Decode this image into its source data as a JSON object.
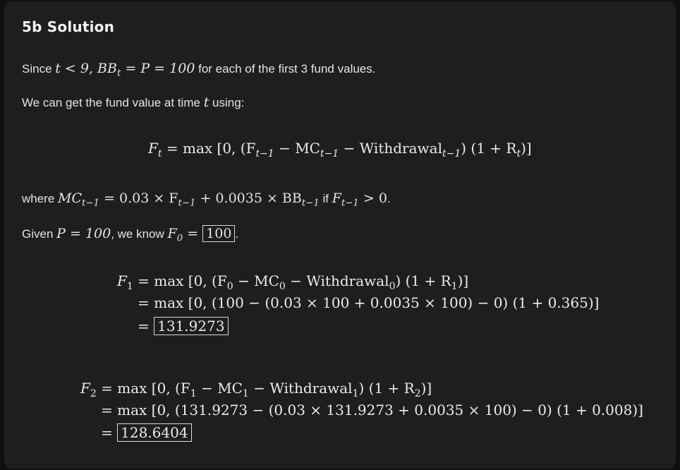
{
  "title": "5b Solution",
  "intro": {
    "prefix": "Since ",
    "cond": "t < 9, BB",
    "cond_sub": "t",
    "cond_rest": " = P = 100",
    "suffix": " for each of the first 3 fund values."
  },
  "line2": {
    "prefix": "We can get the fund value at time ",
    "var": "t",
    "suffix": " using:"
  },
  "general_eq": {
    "lhs": "F",
    "lhs_sub": "t",
    "rhs_a": " = max [0, (F",
    "sub1": "t−1",
    "rhs_b": " − MC",
    "sub2": "t−1",
    "rhs_c": " − Withdrawal",
    "sub3": "t−1",
    "rhs_d": ") (1 + R",
    "sub4": "t",
    "rhs_e": ")]"
  },
  "where": {
    "prefix": "where ",
    "a": "MC",
    "a_sub": "t−1",
    "b": " = 0.03 × F",
    "b_sub": "t−1",
    "c": " + 0.0035 × BB",
    "c_sub": "t−1",
    "mid": " if ",
    "d": "F",
    "d_sub": "t−1",
    "e": " > 0",
    "suffix": "."
  },
  "given": {
    "prefix": "Given ",
    "p": "P = 100",
    "mid": ", we know ",
    "f": "F",
    "f_sub": "0",
    "eq": " = ",
    "value": "100",
    "suffix": "."
  },
  "f1": {
    "line1_lhs": "F",
    "line1_lhs_sub": "1",
    "line1_a": " = max [0, (F",
    "line1_sub_a": "0",
    "line1_b": " − MC",
    "line1_sub_b": "0",
    "line1_c": " − Withdrawal",
    "line1_sub_c": "0",
    "line1_d": ") (1 + R",
    "line1_sub_d": "1",
    "line1_e": ")]",
    "line2": "= max [0, (100 − (0.03 × 100 + 0.0035 × 100) − 0) (1 + 0.365)]",
    "line3_eq": "= ",
    "result": "131.9273"
  },
  "f2": {
    "line1_lhs": "F",
    "line1_lhs_sub": "2",
    "line1_a": " = max [0, (F",
    "line1_sub_a": "1",
    "line1_b": " − MC",
    "line1_sub_b": "1",
    "line1_c": " − Withdrawal",
    "line1_sub_c": "1",
    "line1_d": ") (1 + R",
    "line1_sub_d": "2",
    "line1_e": ")]",
    "line2": "= max [0, (131.9273 − (0.03 × 131.9273 + 0.0035 × 100) − 0) (1 + 0.008)]",
    "line3_eq": "= ",
    "result": "128.6404"
  }
}
